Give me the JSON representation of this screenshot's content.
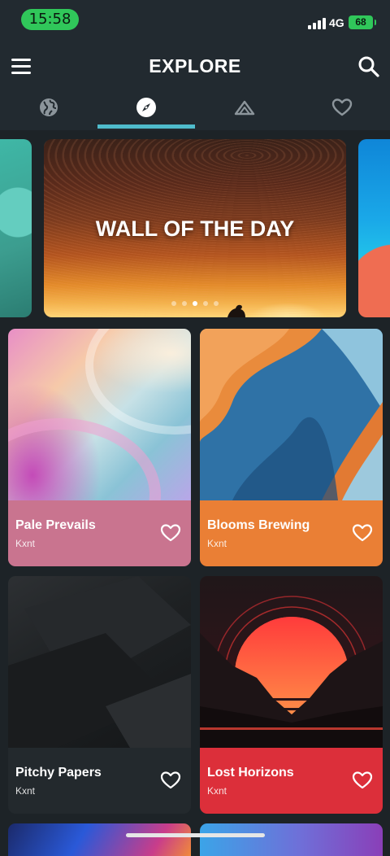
{
  "status_bar": {
    "time": "15:58",
    "network": "4G",
    "battery": "68"
  },
  "app_bar": {
    "title": "EXPLORE"
  },
  "tabs": [
    {
      "id": "globe",
      "icon": "globe-icon",
      "active": false
    },
    {
      "id": "compass",
      "icon": "compass-icon",
      "active": true
    },
    {
      "id": "mountain",
      "icon": "mountain-icon",
      "active": false
    },
    {
      "id": "favorites",
      "icon": "heart-icon",
      "active": false
    }
  ],
  "banner": {
    "title": "WALL OF THE DAY",
    "dots_total": 5,
    "active_dot": 2
  },
  "wallpapers": [
    {
      "name": "Pale Prevails",
      "author": "Kxnt",
      "color": "#c9748f"
    },
    {
      "name": "Blooms Brewing",
      "author": "Kxnt",
      "color": "#ea7f35"
    },
    {
      "name": "Pitchy Papers",
      "author": "Kxnt",
      "color": "#23292d"
    },
    {
      "name": "Lost Horizons",
      "author": "Kxnt",
      "color": "#dc2f3a"
    }
  ],
  "colors": {
    "accent": "#4fbccc",
    "background": "#1d2327",
    "bar": "#222a30"
  }
}
